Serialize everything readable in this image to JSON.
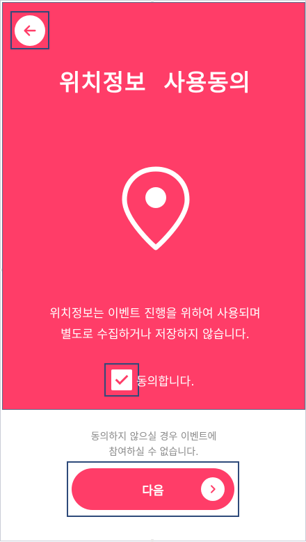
{
  "header": {
    "back_icon": "arrow-left-icon",
    "title": "위치정보  사용동의"
  },
  "illustration": {
    "icon": "location-pin-icon"
  },
  "description": {
    "line1": "위치정보는 이벤트 진행을 위하여 사용되며",
    "line2": "별도로 수집하거나 저장하지 않습니다."
  },
  "consent": {
    "checked": true,
    "check_icon": "checkmark-icon",
    "label": "동의합니다."
  },
  "notice": {
    "line1": "동의하지 않으실 경우 이벤트에",
    "line2": "참여하실 수 없습니다."
  },
  "next_button": {
    "label": "다음",
    "arrow_icon": "chevron-right-icon"
  },
  "colors": {
    "accent": "#ff3d68",
    "white": "#ffffff",
    "muted_text": "#8a8a8a",
    "highlight_border": "#2e4a7a"
  }
}
